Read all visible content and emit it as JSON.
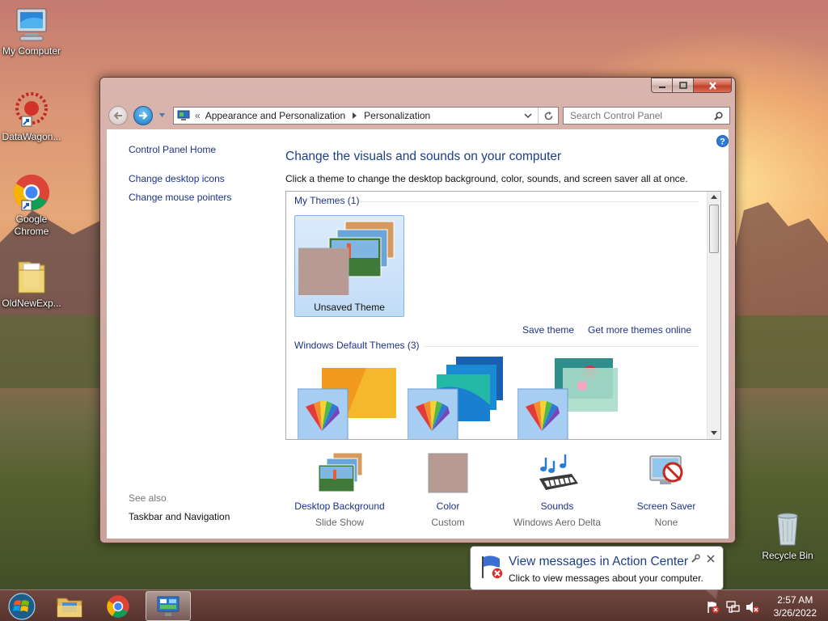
{
  "desktop": {
    "icons": [
      {
        "label": "My Computer",
        "icon": "computer-icon"
      },
      {
        "label": "DataWagon...",
        "icon": "datawagon-icon"
      },
      {
        "label": "Google Chrome",
        "icon": "chrome-icon"
      },
      {
        "label": "OldNewExp...",
        "icon": "folder-icon"
      },
      {
        "label": "Recycle Bin",
        "icon": "recycle-bin-icon"
      }
    ]
  },
  "window": {
    "breadcrumb": {
      "prefix": "«",
      "items": [
        "Appearance and Personalization",
        "Personalization"
      ]
    },
    "search_placeholder": "Search Control Panel",
    "left_nav": {
      "home": "Control Panel Home",
      "links": [
        "Change desktop icons",
        "Change mouse pointers"
      ],
      "see_also_title": "See also",
      "see_also_links": [
        "Taskbar and Navigation"
      ]
    },
    "heading": "Change the visuals and sounds on your computer",
    "subheading": "Click a theme to change the desktop background, color, sounds, and screen saver all at once.",
    "themes": {
      "my_themes_label": "My Themes (1)",
      "unsaved_theme": "Unsaved Theme",
      "save_theme": "Save theme",
      "get_more": "Get more themes online",
      "default_label": "Windows Default Themes (3)"
    },
    "bottom": [
      {
        "label": "Desktop Background",
        "value": "Slide Show",
        "icon": "desktop-background-icon"
      },
      {
        "label": "Color",
        "value": "Custom",
        "icon": "color-swatch-icon"
      },
      {
        "label": "Sounds",
        "value": "Windows Aero Delta",
        "icon": "sounds-icon"
      },
      {
        "label": "Screen Saver",
        "value": "None",
        "icon": "screen-saver-icon"
      }
    ]
  },
  "notification": {
    "title": "View messages in Action Center",
    "body": "Click to view messages about your computer."
  },
  "taskbar": {
    "time": "2:57 AM",
    "date": "3/26/2022",
    "buttons": [
      "start-button",
      "file-explorer",
      "google-chrome",
      "control-panel"
    ]
  },
  "colors": {
    "link": "#1e3287",
    "heading": "#1e3f88",
    "window_frame": "#c9a29b",
    "taskbar": "#784642"
  }
}
